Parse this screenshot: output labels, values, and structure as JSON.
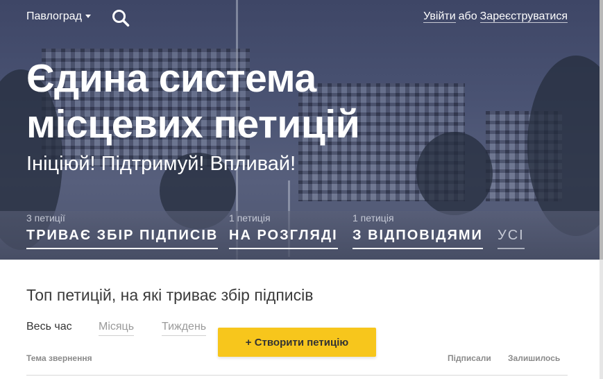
{
  "header": {
    "city": "Павлоград",
    "login_label": "Увійти",
    "or_label": "або",
    "register_label": "Зареєструватися"
  },
  "hero": {
    "title_line1": "Єдина система",
    "title_line2": "місцевих петицій",
    "subtitle": "Ініціюй! Підтримуй! Впливай!"
  },
  "tabs": [
    {
      "count": "3 петиції",
      "label": "ТРИВАЄ ЗБІР ПІДПИСІВ"
    },
    {
      "count": "1 петиція",
      "label": "НА РОЗГЛЯДІ"
    },
    {
      "count": "1 петиція",
      "label": "З ВІДПОВІДЯМИ"
    },
    {
      "count": "",
      "label": "УСІ"
    }
  ],
  "main": {
    "section_title": "Топ петицій, на які триває збір підписів",
    "filters": [
      "Весь час",
      "Місяць",
      "Тиждень"
    ],
    "create_button": "+ Створити петицію",
    "columns": {
      "topic": "Тема звернення",
      "signed": "Підписали",
      "remaining": "Залишилось"
    }
  },
  "colors": {
    "accent": "#f7c61c",
    "hero_overlay": "#4a5373"
  }
}
